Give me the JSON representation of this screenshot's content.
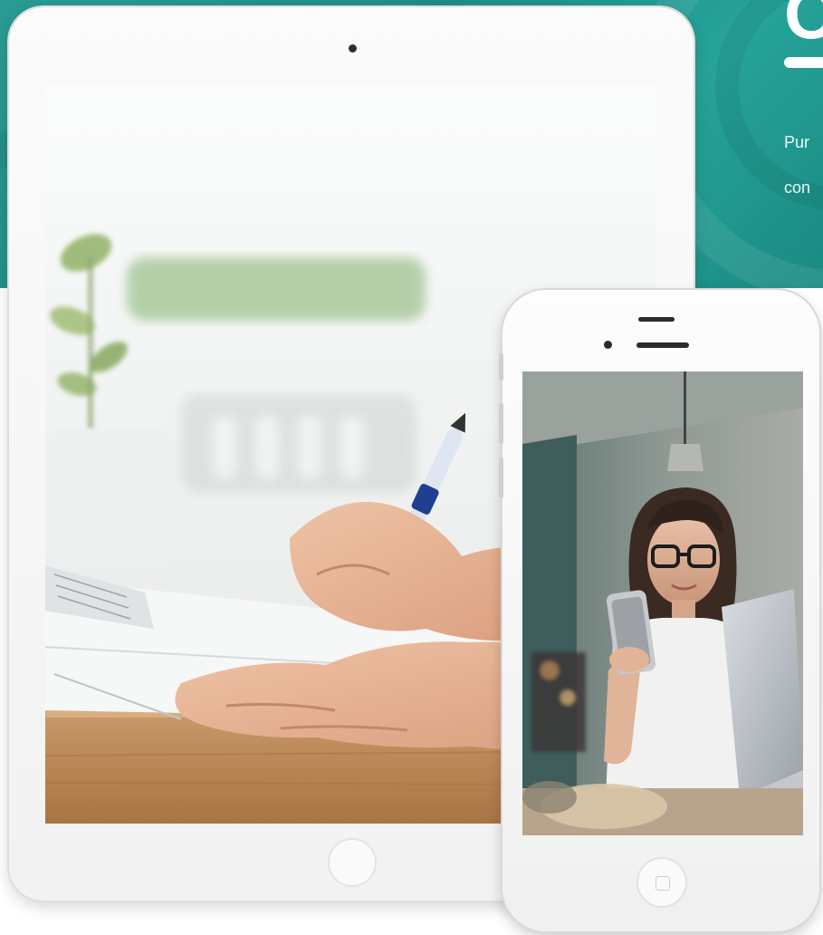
{
  "banner": {
    "heading": "O",
    "text_lines": [
      "Pur",
      "con"
    ],
    "colors": {
      "teal": "#2a9c94",
      "teal_dark": "#1a8a82",
      "text": "#ffffff"
    }
  },
  "tablet": {
    "screen_image": "hands-writing-with-pen-on-notebook-photo",
    "camera_icon": "front-camera-icon",
    "home_icon": "home-button-icon"
  },
  "phone": {
    "screen_image": "woman-with-glasses-holding-phone-at-laptop-photo",
    "camera_icon": "front-camera-icon",
    "speaker_icon": "speaker-grille-icon",
    "home_icon": "home-button-icon"
  }
}
